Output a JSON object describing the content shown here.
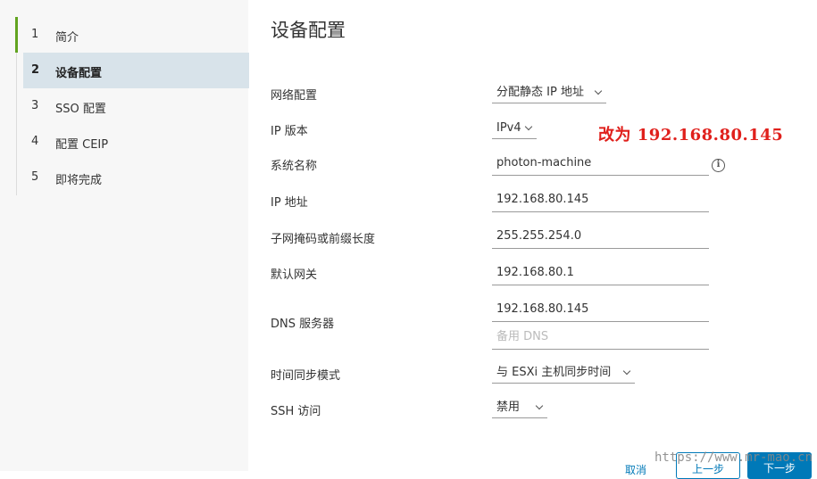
{
  "sidebar": {
    "steps": [
      {
        "num": "1",
        "label": "简介"
      },
      {
        "num": "2",
        "label": "设备配置"
      },
      {
        "num": "3",
        "label": "SSO 配置"
      },
      {
        "num": "4",
        "label": "配置 CEIP"
      },
      {
        "num": "5",
        "label": "即将完成"
      }
    ],
    "active_index": 1
  },
  "main": {
    "title": "设备配置",
    "fields": {
      "network_config": {
        "label": "网络配置",
        "value": "分配静态 IP 地址"
      },
      "ip_version": {
        "label": "IP 版本",
        "value": "IPv4"
      },
      "system_name": {
        "label": "系统名称",
        "value": "photon-machine"
      },
      "ip_address": {
        "label": "IP 地址",
        "value": "192.168.80.145"
      },
      "subnet_mask": {
        "label": "子网掩码或前缀长度",
        "value": "255.255.254.0"
      },
      "gateway": {
        "label": "默认网关",
        "value": "192.168.80.1"
      },
      "dns": {
        "label": "DNS 服务器",
        "value": "192.168.80.145",
        "alt_placeholder": "备用 DNS"
      },
      "time_sync": {
        "label": "时间同步模式",
        "value": "与 ESXi 主机同步时间"
      },
      "ssh": {
        "label": "SSH 访问",
        "value": "禁用"
      }
    },
    "info_icon": "info-icon"
  },
  "annotation": "改为 192.168.80.145",
  "footer": {
    "cancel": "取消",
    "back": "上一步",
    "next": "下一步"
  },
  "watermark": "https://www.mr-mao.cn",
  "colors": {
    "accent_green": "#62a420",
    "active_bg": "#d8e3ea",
    "primary_blue": "#0079b8",
    "annotation_red": "#e0201c"
  }
}
